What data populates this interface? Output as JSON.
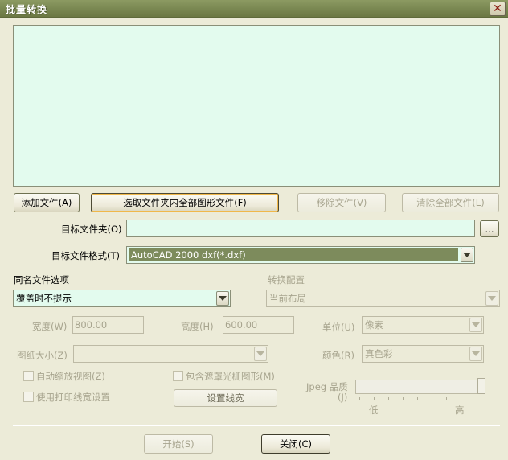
{
  "window": {
    "title": "批量转换",
    "close_glyph": "✕"
  },
  "buttons": {
    "add_file": "添加文件(A)",
    "select_folder_all": "选取文件夹内全部图形文件(F)",
    "remove_file": "移除文件(V)",
    "clear_all": "清除全部文件(L)",
    "browse": "...",
    "set_linewidth": "设置线宽",
    "start": "开始(S)",
    "close": "关闭(C)"
  },
  "fields": {
    "target_folder_label": "目标文件夹(O)",
    "target_folder_value": "",
    "target_format_label": "目标文件格式(T)",
    "target_format_value": "AutoCAD 2000 dxf(*.dxf)",
    "same_name_label": "同名文件选项",
    "same_name_value": "覆盖时不提示",
    "convert_config_label": "转换配置",
    "convert_config_value": "当前布局",
    "width_label": "宽度(W)",
    "width_value": "800.00",
    "height_label": "高度(H)",
    "height_value": "600.00",
    "unit_label": "单位(U)",
    "unit_value": "像素",
    "paper_size_label": "图纸大小(Z)",
    "paper_size_value": "",
    "color_label": "颜色(R)",
    "color_value": "真色彩"
  },
  "checkboxes": {
    "auto_zoom": {
      "label": "自动缩放视图(Z)",
      "checked": false
    },
    "use_print_linewidth": {
      "label": "使用打印线宽设置",
      "checked": false
    },
    "include_mask_raster": {
      "label": "包含遮罩光栅图形(M)",
      "checked": false
    }
  },
  "jpeg_quality": {
    "label_line1": "Jpeg 品质",
    "label_line2": "(J)",
    "low": "低",
    "high": "高",
    "level": 1.0
  },
  "colors": {
    "accent": "#7d8b5c",
    "title_bar": "#7c8a54",
    "list_bg": "#e3fbee"
  }
}
